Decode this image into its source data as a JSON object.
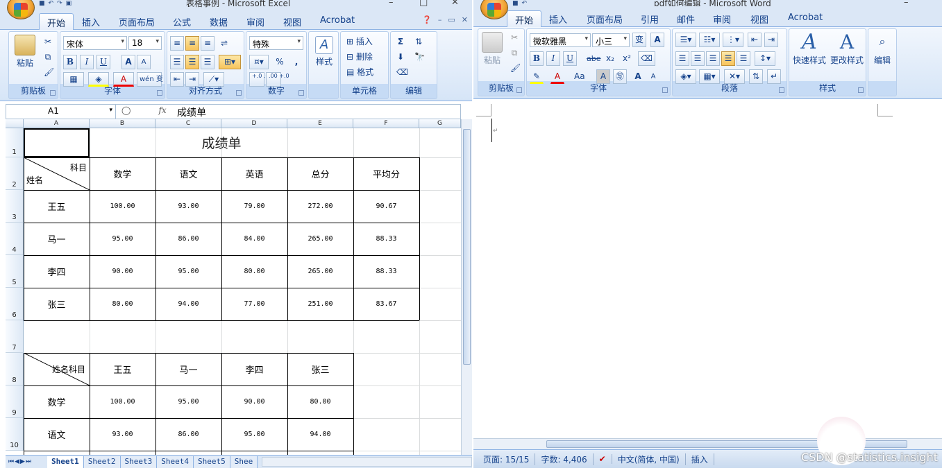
{
  "excel": {
    "title": "表格事例 - Microsoft Excel",
    "tabs": [
      "开始",
      "插入",
      "页面布局",
      "公式",
      "数据",
      "审阅",
      "视图",
      "Acrobat"
    ],
    "ribbon": {
      "paste": "粘贴",
      "clipboard": "剪贴板",
      "font_name": "宋体",
      "font_size": "18",
      "font_group": "字体",
      "align_group": "对齐方式",
      "number_format": "特殊",
      "number_group": "数字",
      "style": "样式",
      "insert": "插入",
      "delete": "删除",
      "format": "格式",
      "cells_group": "单元格",
      "edit_group": "编辑",
      "bold": "B",
      "italic": "I",
      "underline": "U",
      "grow": "A",
      "shrink": "A",
      "wen": "wén 变",
      "percent": "%",
      "comma": ",",
      "sigma": "Σ",
      "inc": "+.0 .00",
      "dec": ".00 +.0"
    },
    "name_box": "A1",
    "fx_label": "fx",
    "formula": "成绩单",
    "columns": [
      "A",
      "B",
      "C",
      "D",
      "E",
      "F",
      "G"
    ],
    "rows": [
      "1",
      "2",
      "3",
      "4",
      "5",
      "6",
      "7",
      "8",
      "9",
      "10"
    ],
    "table1": {
      "title": "成绩单",
      "corner_top": "科目",
      "corner_bottom": "姓名",
      "headers": [
        "数学",
        "语文",
        "英语",
        "总分",
        "平均分"
      ],
      "data": [
        [
          "王五",
          "100.00",
          "93.00",
          "79.00",
          "272.00",
          "90.67"
        ],
        [
          "马一",
          "95.00",
          "86.00",
          "84.00",
          "265.00",
          "88.33"
        ],
        [
          "李四",
          "90.00",
          "95.00",
          "80.00",
          "265.00",
          "88.33"
        ],
        [
          "张三",
          "80.00",
          "94.00",
          "77.00",
          "251.00",
          "83.67"
        ]
      ]
    },
    "table2": {
      "corner": "姓名科目",
      "headers": [
        "王五",
        "马一",
        "李四",
        "张三"
      ],
      "data": [
        [
          "数学",
          "100.00",
          "95.00",
          "90.00",
          "80.00"
        ],
        [
          "语文",
          "93.00",
          "86.00",
          "95.00",
          "94.00"
        ]
      ]
    },
    "sheets": [
      "Sheet1",
      "Sheet2",
      "Sheet3",
      "Sheet4",
      "Sheet5",
      "Shee"
    ]
  },
  "word": {
    "title": "pdf如何编辑 - Microsoft Word",
    "tabs": [
      "开始",
      "插入",
      "页面布局",
      "引用",
      "邮件",
      "审阅",
      "视图",
      "Acrobat"
    ],
    "ribbon": {
      "paste": "粘贴",
      "clipboard": "剪贴板",
      "font_name": "微软雅黑",
      "font_size": "小三",
      "font_group": "字体",
      "para_group": "段落",
      "quick_style": "快速样式",
      "change_style": "更改样式",
      "style_group": "样式",
      "edit": "编辑",
      "bold": "B",
      "italic": "I",
      "underline": "U",
      "strike": "abe",
      "sub": "x₂",
      "sup": "x²",
      "aa": "Aa",
      "grow": "A",
      "shrink": "A"
    },
    "status": [
      "页面: 15/15",
      "字数: 4,406",
      "中文(简体, 中国)",
      "插入"
    ],
    "watermark": "CSDN @statistics.insight"
  }
}
